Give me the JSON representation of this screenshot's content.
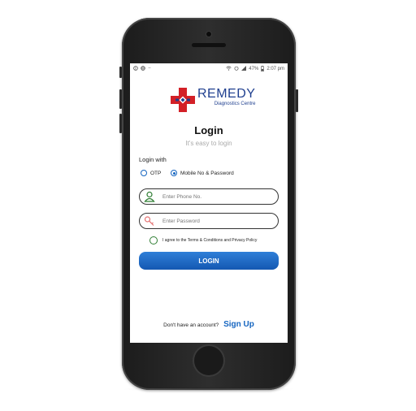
{
  "status_bar": {
    "left_icons": [
      "debug-icon",
      "globe-icon",
      "more-icon"
    ],
    "battery": "47%",
    "time": "2:07 pm"
  },
  "brand": {
    "name": "REMEDY",
    "subtitle": "Diagnostics Centre",
    "colors": {
      "cross": "#d32027",
      "text": "#1f3f8f"
    }
  },
  "login": {
    "title": "Login",
    "subtitle": "It's easy to login",
    "login_with_label": "Login with",
    "options": [
      {
        "label": "OTP",
        "selected": false
      },
      {
        "label": "Mobile No & Password",
        "selected": true
      }
    ],
    "phone_placeholder": "Enter Phone No.",
    "password_placeholder": "Enter Password",
    "agree_text": "I agree to the Terms & Conditions and Privacy Policy",
    "button_label": "LOGIN",
    "accent": "#1565c0"
  },
  "footer": {
    "question": "Don't have an account?",
    "signup_label": "Sign Up"
  }
}
